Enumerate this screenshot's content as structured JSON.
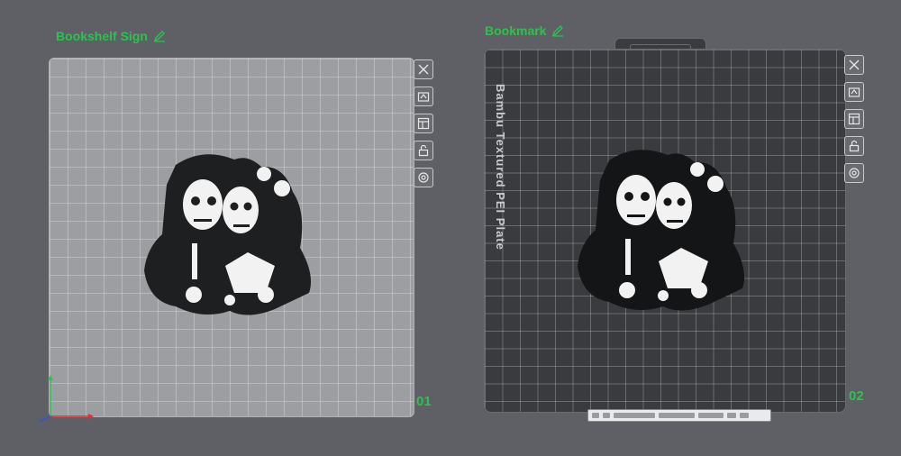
{
  "plates": [
    {
      "title": "Bookshelf Sign",
      "number": "01"
    },
    {
      "title": "Bookmark",
      "number": "02",
      "plate_label": "Bambu Textured PEI Plate"
    }
  ],
  "icons": {
    "edit": "pencil-icon",
    "tools": [
      "close-icon",
      "auto-arrange-icon",
      "orient-icon",
      "lock-icon",
      "settings-icon"
    ]
  },
  "colors": {
    "accent": "#2fc04f",
    "background": "#5f6065",
    "plate1": "#9c9ea2",
    "plate2": "#3a3b3e"
  }
}
